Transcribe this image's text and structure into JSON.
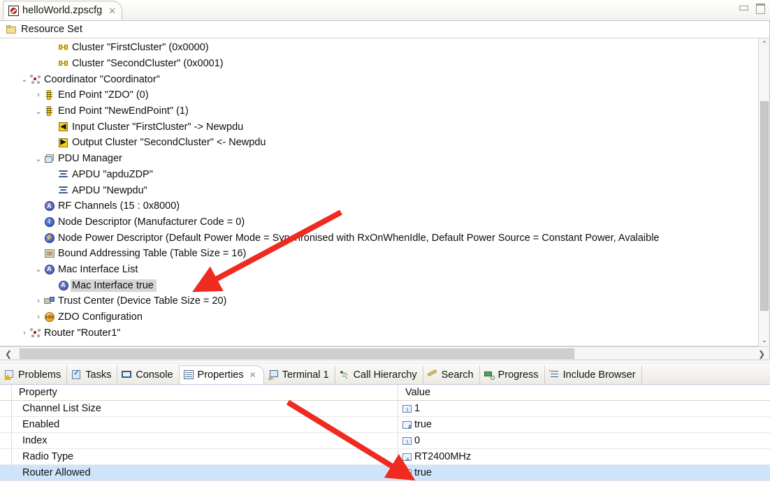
{
  "window": {
    "minimize_label": "Minimize",
    "maximize_label": "Maximize"
  },
  "editor": {
    "tab": {
      "title": "helloWorld.zpscfg",
      "close_label": "✕",
      "icon": "zpscfg-file-icon"
    },
    "resource_set": {
      "label": "Resource Set",
      "icon": "folder-icon"
    },
    "tree": [
      {
        "indent": 3,
        "twisty": "",
        "icon": "cluster",
        "label": "Cluster \"FirstCluster\" (0x0000)",
        "selected": false
      },
      {
        "indent": 3,
        "twisty": "",
        "icon": "cluster",
        "label": "Cluster \"SecondCluster\" (0x0001)",
        "selected": false
      },
      {
        "indent": 1,
        "twisty": "v",
        "icon": "node",
        "label": "Coordinator \"Coordinator\"",
        "selected": false
      },
      {
        "indent": 2,
        "twisty": ">",
        "icon": "endpoint",
        "label": "End Point \"ZDO\" (0)",
        "selected": false
      },
      {
        "indent": 2,
        "twisty": "v",
        "icon": "endpoint",
        "label": "End Point \"NewEndPoint\" (1)",
        "selected": false
      },
      {
        "indent": 3,
        "twisty": "",
        "icon": "incluster",
        "label": "Input Cluster \"FirstCluster\" -> Newpdu",
        "selected": false
      },
      {
        "indent": 3,
        "twisty": "",
        "icon": "outcluster",
        "label": "Output Cluster \"SecondCluster\" <- Newpdu",
        "selected": false
      },
      {
        "indent": 2,
        "twisty": "v",
        "icon": "pdumgr",
        "label": "PDU Manager",
        "selected": false
      },
      {
        "indent": 3,
        "twisty": "",
        "icon": "apdu",
        "label": "APDU \"apduZDP\"",
        "selected": false
      },
      {
        "indent": 3,
        "twisty": "",
        "icon": "apdu",
        "label": "APDU \"Newpdu\"",
        "selected": false
      },
      {
        "indent": 2,
        "twisty": "",
        "icon": "rf",
        "label": "RF Channels (15 : 0x8000)",
        "selected": false
      },
      {
        "indent": 2,
        "twisty": "",
        "icon": "info",
        "label": "Node Descriptor (Manufacturer Code = 0)",
        "selected": false
      },
      {
        "indent": 2,
        "twisty": "",
        "icon": "power",
        "label": "Node Power Descriptor (Default Power Mode = Synchronised with RxOnWhenIdle, Default Power Source = Constant Power, Avalaible",
        "selected": false
      },
      {
        "indent": 2,
        "twisty": "",
        "icon": "bound",
        "label": "Bound Addressing Table (Table Size = 16)",
        "selected": false
      },
      {
        "indent": 2,
        "twisty": "v",
        "icon": "rf",
        "label": "Mac Interface List",
        "selected": false
      },
      {
        "indent": 3,
        "twisty": "",
        "icon": "rf",
        "label": "Mac Interface true",
        "selected": true
      },
      {
        "indent": 2,
        "twisty": ">",
        "icon": "trust",
        "label": "Trust Center (Device Table Size = 20)",
        "selected": false
      },
      {
        "indent": 2,
        "twisty": ">",
        "icon": "zdo",
        "label": "ZDO Configuration",
        "selected": false
      },
      {
        "indent": 1,
        "twisty": ">",
        "icon": "node",
        "label": "Router \"Router1\"",
        "selected": false
      }
    ],
    "vscroll": {
      "up": "⌃",
      "down": "⌄"
    },
    "hscroll": {
      "left": "❮",
      "right": "❯"
    }
  },
  "view_tabs": [
    {
      "label": "Problems",
      "icon": "problems-icon",
      "active": false,
      "closable": false
    },
    {
      "label": "Tasks",
      "icon": "tasks-icon",
      "active": false,
      "closable": false
    },
    {
      "label": "Console",
      "icon": "console-icon",
      "active": false,
      "closable": false
    },
    {
      "label": "Properties",
      "icon": "properties-icon",
      "active": true,
      "closable": true
    },
    {
      "label": "Terminal 1",
      "icon": "terminal-icon",
      "active": false,
      "closable": false
    },
    {
      "label": "Call Hierarchy",
      "icon": "call-hierarchy-icon",
      "active": false,
      "closable": false
    },
    {
      "label": "Search",
      "icon": "search-icon",
      "active": false,
      "closable": false
    },
    {
      "label": "Progress",
      "icon": "progress-icon",
      "active": false,
      "closable": false
    },
    {
      "label": "Include Browser",
      "icon": "include-browser-icon",
      "active": false,
      "closable": false
    }
  ],
  "properties": {
    "columns": {
      "property": "Property",
      "value": "Value"
    },
    "rows": [
      {
        "property": "Channel List Size",
        "value": "1",
        "value_icon": "num",
        "selected": false
      },
      {
        "property": "Enabled",
        "value": "true",
        "value_icon": "bool",
        "selected": false
      },
      {
        "property": "Index",
        "value": "0",
        "value_icon": "num",
        "selected": false
      },
      {
        "property": "Radio Type",
        "value": "RT2400MHz",
        "value_icon": "enum",
        "selected": false
      },
      {
        "property": "Router Allowed",
        "value": "true",
        "value_icon": "bool",
        "selected": true
      }
    ]
  },
  "annotations": {
    "arrow_color": "#ee2a21",
    "arrow_1_target": "Mac Interface true",
    "arrow_2_target": "Router Allowed value true"
  }
}
